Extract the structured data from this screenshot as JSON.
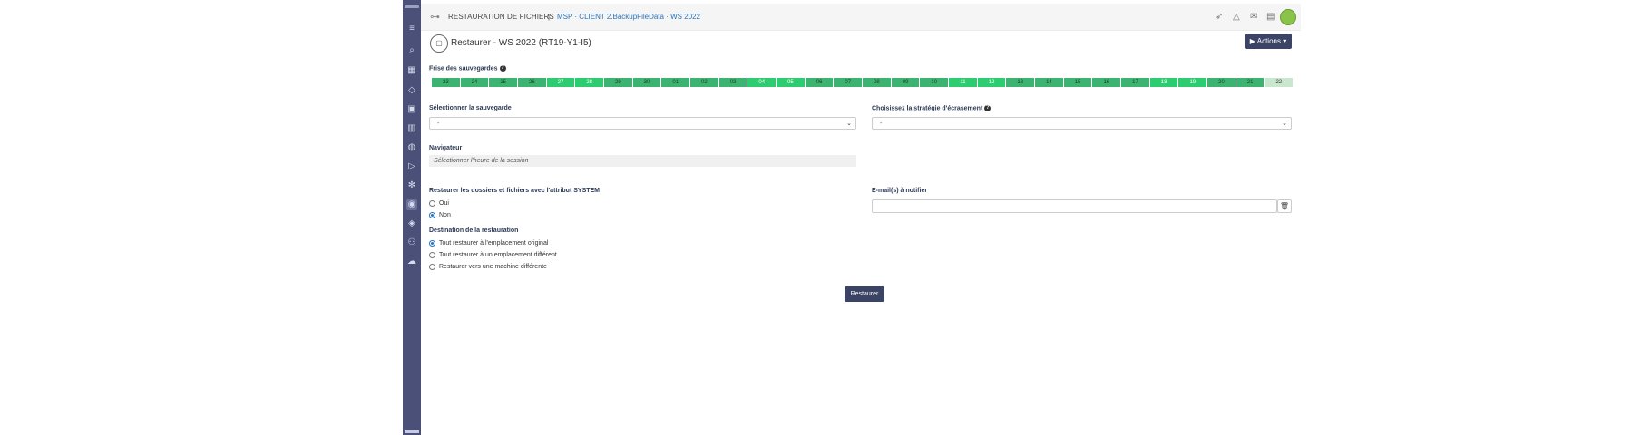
{
  "sidebar": {
    "icons": [
      "menu-icon",
      "search-icon",
      "grid-icon",
      "tag-icon",
      "image-icon",
      "chart-icon",
      "palette-icon",
      "play-icon",
      "gear-icon",
      "restore-icon",
      "shield-icon",
      "users-icon",
      "cloud-icon"
    ]
  },
  "topbar": {
    "title": "RESTAURATION DE FICHIERS",
    "separator": "|",
    "breadcrumb": "MSP · CLIENT 2.BackupFileData · WS 2022"
  },
  "page": {
    "title": "Restaurer - WS 2022 (RT19-Y1-I5)",
    "actions_label": "▶ Actions ▾"
  },
  "timeline": {
    "label": "Frise des sauvegardes",
    "days": [
      "23",
      "24",
      "25",
      "26",
      "27",
      "28",
      "29",
      "30",
      "01",
      "02",
      "03",
      "04",
      "05",
      "06",
      "07",
      "08",
      "09",
      "10",
      "11",
      "12",
      "13",
      "14",
      "15",
      "16",
      "17",
      "18",
      "19",
      "20",
      "21",
      "22"
    ]
  },
  "backup_select": {
    "label": "Sélectionner la sauvegarde",
    "value": "-"
  },
  "strategy_select": {
    "label": "Choisissez la stratégie d'écrasement",
    "value": "-"
  },
  "navigator": {
    "label": "Navigateur",
    "placeholder": "Sélectionner l'heure de la session"
  },
  "system_attr": {
    "label": "Restaurer les dossiers et fichiers avec l'attribut SYSTEM",
    "options": [
      "Oui",
      "Non"
    ],
    "selected": "Non"
  },
  "destination": {
    "label": "Destination de la restauration",
    "options": [
      "Tout restaurer à l'emplacement original",
      "Tout restaurer à un emplacement différent",
      "Restaurer vers une machine différente"
    ],
    "selected": "Tout restaurer à l'emplacement original"
  },
  "email": {
    "label": "E-mail(s) à notifier",
    "value": ""
  },
  "restore_button": "Restaurer",
  "colors": {
    "sidebar": "#4a5078",
    "primary_button": "#3c4465",
    "timeline_green": "#3cb371",
    "timeline_bright": "#2ecc71",
    "timeline_last": "#c9e7cf",
    "link": "#2b73b8"
  }
}
